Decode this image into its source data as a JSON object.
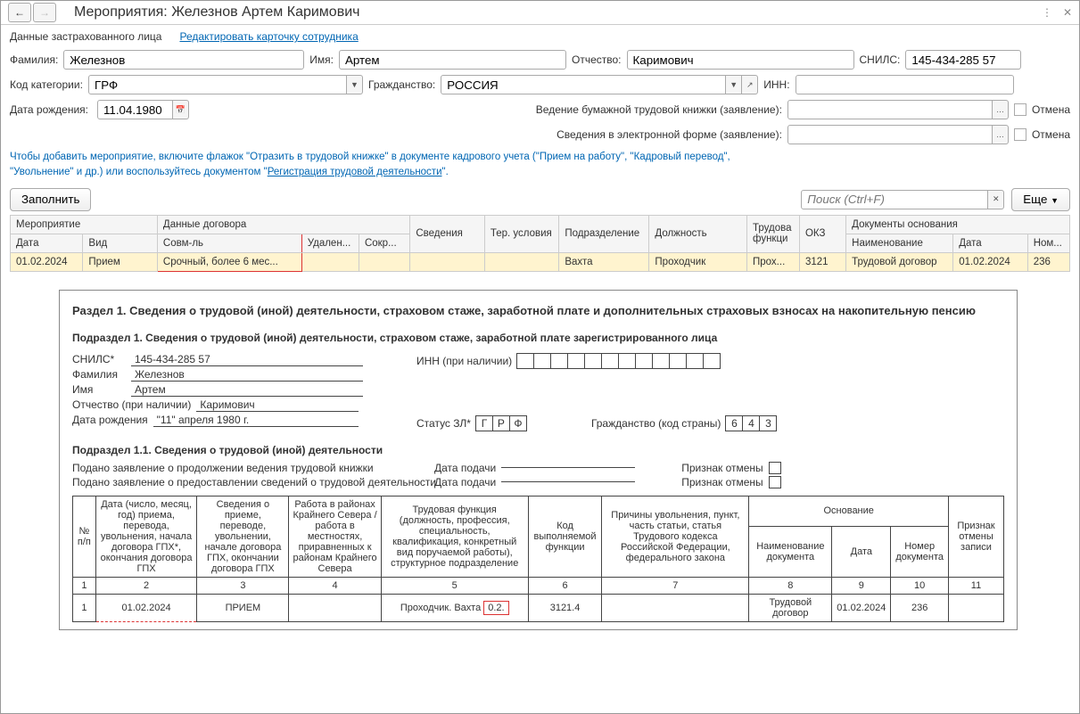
{
  "titlebar": {
    "title": "Мероприятия: Железнов Артем Каримович"
  },
  "section": {
    "header": "Данные застрахованного лица",
    "edit_link": "Редактировать карточку сотрудника"
  },
  "form": {
    "lastname_lbl": "Фамилия:",
    "lastname": "Железнов",
    "firstname_lbl": "Имя:",
    "firstname": "Артем",
    "patronymic_lbl": "Отчество:",
    "patronymic": "Каримович",
    "snils_lbl": "СНИЛС:",
    "snils": "145-434-285 57",
    "category_lbl": "Код категории:",
    "category": "ГРФ",
    "citizenship_lbl": "Гражданство:",
    "citizenship": "РОССИЯ",
    "inn_lbl": "ИНН:",
    "inn": "",
    "dob_lbl": "Дата рождения:",
    "dob": "11.04.1980",
    "paper_lbl": "Ведение бумажной трудовой книжки (заявление):",
    "electronic_lbl": "Сведения в электронной форме (заявление):",
    "cancel_lbl": "Отмена"
  },
  "hint": {
    "line1a": "Чтобы добавить мероприятие, включите флажок \"Отразить в трудовой книжке\" в документе кадрового учета (\"Прием на работу\", \"Кадровый перевод\",",
    "line2a": "\"Увольнение\" и др.) или воспользуйтесь документом \"",
    "line2_link": "Регистрация трудовой деятельности",
    "line2b": "\"."
  },
  "toolbar": {
    "fill": "Заполнить",
    "search_ph": "Поиск (Ctrl+F)",
    "more": "Еще"
  },
  "grid": {
    "h_event": "Мероприятие",
    "h_contract": "Данные договора",
    "h_info": "Сведения",
    "h_ter": "Тер. условия",
    "h_dept": "Подразделение",
    "h_position": "Должность",
    "h_laborfn": "Трудова функци",
    "h_okz": "ОКЗ",
    "h_docs": "Документы основания",
    "h_date": "Дата",
    "h_type": "Вид",
    "h_combine": "Совм-ль",
    "h_remote": "Удален...",
    "h_short": "Сокр...",
    "h_docname": "Наименование",
    "h_docdate": "Дата",
    "h_docnum": "Ном...",
    "row": {
      "date": "01.02.2024",
      "type": "Прием",
      "combine": "Срочный, более 6 мес...",
      "remote": "",
      "short": "",
      "info": "",
      "ter": "",
      "dept": "Вахта",
      "position": "Проходчик",
      "laborfn": "Прох...",
      "okz": "3121",
      "docname": "Трудовой договор",
      "docdate": "01.02.2024",
      "docnum": "236"
    }
  },
  "pf": {
    "title": "Раздел 1. Сведения о трудовой (иной) деятельности, страховом стаже, заработной плате и дополнительных страховых взносах на накопительную пенсию",
    "sub1": "Подраздел 1. Сведения о трудовой (иной) деятельности, страховом стаже, заработной плате зарегистрированного лица",
    "snils_lbl": "СНИЛС*",
    "snils": "145-434-285 57",
    "inn_lbl": "ИНН (при наличии)",
    "lastname_lbl": "Фамилия",
    "lastname": "Железнов",
    "firstname_lbl": "Имя",
    "firstname": "Артем",
    "patronymic_lbl": "Отчество (при наличии)",
    "patronymic": "Каримович",
    "dob_lbl": "Дата рождения",
    "dob": "\"11\" апреля 1980 г.",
    "status_lbl": "Статус ЗЛ*",
    "status_g": "Г",
    "status_r": "Р",
    "status_f": "Ф",
    "citizenship_lbl": "Гражданство (код страны)",
    "cz1": "6",
    "cz2": "4",
    "cz3": "3",
    "sub11": "Подраздел 1.1. Сведения о трудовой (иной) деятельности",
    "paper_stmt": "Подано заявление о продолжении ведения трудовой книжки",
    "elec_stmt": "Подано заявление о предоставлении сведений о трудовой деятельности",
    "filed_lbl": "Дата подачи",
    "cancel_flag_lbl": "Признак отмены",
    "table": {
      "h_num": "№ п/п",
      "h_c2": "Дата (число, месяц, год) приема, перевода, увольнения, начала договора ГПХ*, окончания договора ГПХ",
      "h_c3": "Сведения о приеме, переводе, увольнении, начале договора ГПХ, окончании договора ГПХ",
      "h_c4": "Работа в районах Крайнего Севера / работа в местностях, приравненных к районам Крайнего Севера",
      "h_c5": "Трудовая функция (должность, профессия, специальность, квалификация, конкретный вид поручаемой работы), структурное подразделение",
      "h_c6": "Код выполняемой функции",
      "h_c7": "Причины увольнения, пункт, часть статьи, статья Трудового кодекса Российской Федерации, федерального закона",
      "h_basis": "Основание",
      "h_c8": "Наименование документа",
      "h_c9": "Дата",
      "h_c10": "Номер документа",
      "h_c11": "Признак отмены записи",
      "n1": "1",
      "n2": "2",
      "n3": "3",
      "n4": "4",
      "n5": "5",
      "n6": "6",
      "n7": "7",
      "n8": "8",
      "n9": "9",
      "n10": "10",
      "n11": "11",
      "row": {
        "num": "1",
        "date": "01.02.2024",
        "action": "ПРИЕМ",
        "func_a": "Проходчик. Вахта ",
        "func_b": "0.2.",
        "code": "3121.4",
        "docname": "Трудовой договор",
        "docdate": "01.02.2024",
        "docnum": "236"
      }
    }
  }
}
